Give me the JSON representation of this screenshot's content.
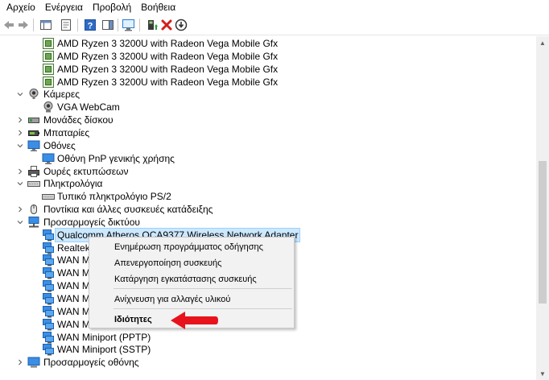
{
  "menu": [
    "Αρχείο",
    "Ενέργεια",
    "Προβολή",
    "Βοήθεια"
  ],
  "colors": {
    "accent": "#0078d7",
    "selection": "#cce8ff",
    "arrow": "#e8121c",
    "remove": "#d41d1d",
    "green": "#2e9b3a"
  },
  "tree": [
    {
      "label": "AMD Ryzen 3 3200U with Radeon Vega Mobile Gfx",
      "icon": "processor-icon",
      "level": 2
    },
    {
      "label": "AMD Ryzen 3 3200U with Radeon Vega Mobile Gfx",
      "icon": "processor-icon",
      "level": 2
    },
    {
      "label": "AMD Ryzen 3 3200U with Radeon Vega Mobile Gfx",
      "icon": "processor-icon",
      "level": 2
    },
    {
      "label": "AMD Ryzen 3 3200U with Radeon Vega Mobile Gfx",
      "icon": "processor-icon",
      "level": 2
    },
    {
      "label": "Κάμερες",
      "icon": "camera-icon",
      "level": 1,
      "expanded": true
    },
    {
      "label": "VGA WebCam",
      "icon": "webcam-icon",
      "level": 2
    },
    {
      "label": "Μονάδες δίσκου",
      "icon": "disk-drive-icon",
      "level": 1,
      "expanded": false
    },
    {
      "label": "Μπαταρίες",
      "icon": "battery-icon",
      "level": 1,
      "expanded": false
    },
    {
      "label": "Οθόνες",
      "icon": "monitor-icon",
      "level": 1,
      "expanded": true
    },
    {
      "label": "Οθόνη PnP γενικής χρήσης",
      "icon": "monitor-icon",
      "level": 2
    },
    {
      "label": "Ουρές εκτυπώσεων",
      "icon": "printer-icon",
      "level": 1,
      "expanded": false
    },
    {
      "label": "Πληκτρολόγια",
      "icon": "keyboard-icon",
      "level": 1,
      "expanded": true
    },
    {
      "label": "Τυπικό πληκτρολόγιο PS/2",
      "icon": "keyboard-icon",
      "level": 2
    },
    {
      "label": "Ποντίκια και άλλες συσκευές κατάδειξης",
      "icon": "mouse-icon",
      "level": 1,
      "expanded": false
    },
    {
      "label": "Προσαρμογείς δικτύου",
      "icon": "network-icon",
      "level": 1,
      "expanded": true
    },
    {
      "label": "Qualcomm Atheros QCA9377 Wireless Network Adapter",
      "icon": "network-adapter-icon",
      "level": 2,
      "selected": true
    },
    {
      "label": "Realtek P",
      "icon": "network-adapter-icon",
      "level": 2
    },
    {
      "label": "WAN Mi",
      "icon": "network-adapter-icon",
      "level": 2
    },
    {
      "label": "WAN Mi",
      "icon": "network-adapter-icon",
      "level": 2
    },
    {
      "label": "WAN Mi",
      "icon": "network-adapter-icon",
      "level": 2
    },
    {
      "label": "WAN Mi",
      "icon": "network-adapter-icon",
      "level": 2
    },
    {
      "label": "WAN Mi",
      "icon": "network-adapter-icon",
      "level": 2
    },
    {
      "label": "WAN Mi",
      "icon": "network-adapter-icon",
      "level": 2
    },
    {
      "label": "WAN Miniport (PPTP)",
      "icon": "network-adapter-icon",
      "level": 2
    },
    {
      "label": "WAN Miniport (SSTP)",
      "icon": "network-adapter-icon",
      "level": 2
    },
    {
      "label": "Προσαρμογείς οθόνης",
      "icon": "display-adapter-icon",
      "level": 1,
      "expanded": false
    }
  ],
  "context_menu": {
    "update_driver": "Ενημέρωση προγράμματος οδήγησης",
    "disable_device": "Απενεργοποίηση συσκευής",
    "uninstall_device": "Κατάργηση εγκατάστασης συσκευής",
    "scan_hardware": "Ανίχνευση για αλλαγές υλικού",
    "properties": "Ιδιότητες"
  }
}
